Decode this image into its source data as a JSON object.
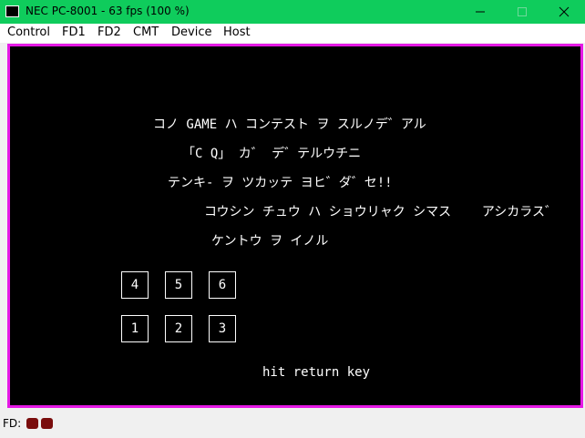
{
  "window": {
    "title": "NEC PC-8001 - 63 fps (100 %)"
  },
  "menu": [
    "Control",
    "FD1",
    "FD2",
    "CMT",
    "Device",
    "Host"
  ],
  "screen": {
    "lines": [
      "コノ GAME ハ コンテスト ヲ スルノデ゛アル",
      "「C Q」 カ゛ デ゛テルウチニ",
      "テンキ- ヲ ツカッテ ヨヒ゛ダ゛セ!!",
      "コウシン チュウ ハ ショウリャク シマス    アシカラス゛",
      "ケントウ ヲ イノル"
    ],
    "keys_top": [
      "4",
      "5",
      "6"
    ],
    "keys_bottom": [
      "1",
      "2",
      "3"
    ],
    "prompt": "hit return key"
  },
  "status": {
    "fd_label": "FD:"
  },
  "colors": {
    "titlebar": "#0fcc5c",
    "screen_border": "#e619e6",
    "screen_bg": "#000000",
    "fd_led": "#7a0d0d"
  }
}
